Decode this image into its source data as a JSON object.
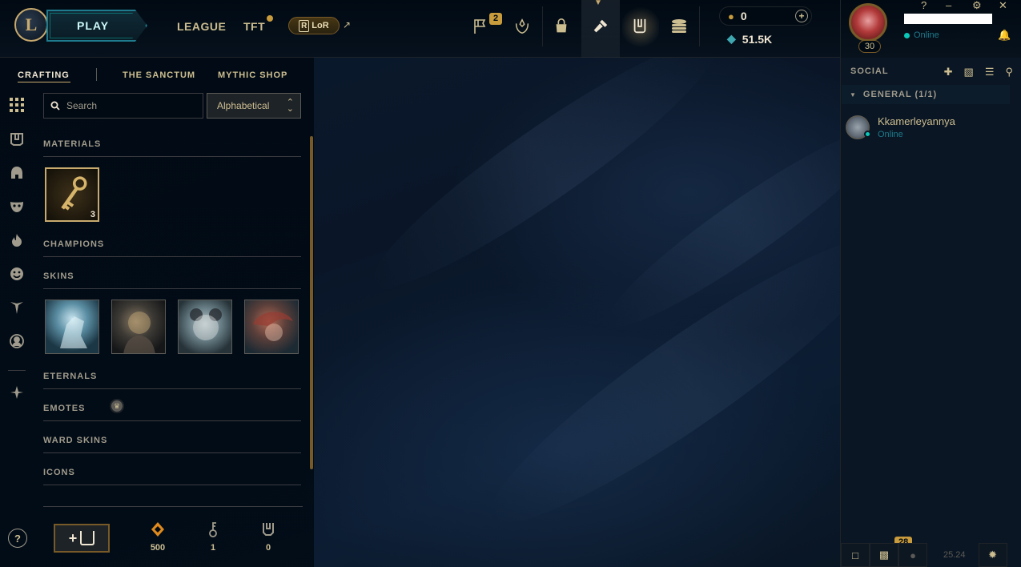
{
  "header": {
    "logo_text": "L",
    "play_label": "PLAY",
    "nav": [
      {
        "label": "LEAGUE"
      },
      {
        "label": "TFT"
      }
    ],
    "lor_label": "LoR",
    "lor_letter": "R",
    "missions_badge": "2",
    "rp_value": "0",
    "be_value": "51.5K"
  },
  "profile": {
    "level": "30",
    "status": "Online"
  },
  "window_controls": [
    "?",
    "–",
    "⚙",
    "✕"
  ],
  "social": {
    "title": "SOCIAL",
    "group_label": "GENERAL (1/1)",
    "friends": [
      {
        "name": "Kkamerleyannya",
        "status": "Online"
      }
    ],
    "chat_badge": "28",
    "version": "25.24"
  },
  "crafting": {
    "tabs": [
      {
        "label": "CRAFTING"
      },
      {
        "label": "THE SANCTUM"
      },
      {
        "label": "MYTHIC SHOP"
      }
    ],
    "search_placeholder": "Search",
    "sort_value": "Alphabetical",
    "sections": [
      {
        "label": "MATERIALS"
      },
      {
        "label": "CHAMPIONS"
      },
      {
        "label": "SKINS"
      },
      {
        "label": "ETERNALS"
      },
      {
        "label": "EMOTES"
      },
      {
        "label": "WARD SKINS"
      },
      {
        "label": "ICONS"
      }
    ],
    "materials": [
      {
        "name": "key-fragment",
        "count": "3"
      }
    ],
    "resources": [
      {
        "icon": "orange-essence-icon",
        "value": "500"
      },
      {
        "icon": "key-icon",
        "value": "1"
      },
      {
        "icon": "chest-icon",
        "value": "0"
      }
    ],
    "help_label": "?"
  },
  "colors": {
    "gold": "#c8aa6e",
    "teal": "#0ac8b9",
    "text": "#cdbe91",
    "background": "#010a13"
  }
}
